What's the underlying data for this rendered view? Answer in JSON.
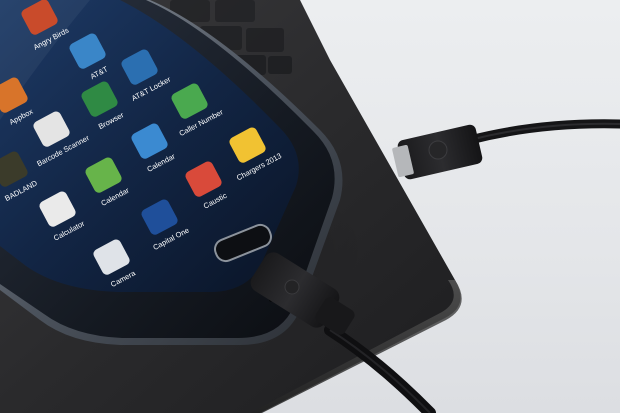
{
  "scene": {
    "subject": "phone-charging-from-laptop"
  },
  "apps": [
    {
      "label": "Angry Birds",
      "icon": "angry-birds-icon",
      "color": "#c94b2b"
    },
    {
      "label": "AT&T",
      "icon": "att-icon",
      "color": "#3a86c8"
    },
    {
      "label": "AT&T Locker",
      "icon": "att-locker-icon",
      "color": "#2b6fb1"
    },
    {
      "label": "Appbox",
      "icon": "appbox-icon",
      "color": "#d8742a"
    },
    {
      "label": "Barcode Scanner",
      "icon": "barcode-scanner-icon",
      "color": "#e4e4e4"
    },
    {
      "label": "Browser",
      "icon": "browser-icon",
      "color": "#2f8a44"
    },
    {
      "label": "Caller Number",
      "icon": "caller-number-icon",
      "color": "#4aa94f"
    },
    {
      "label": "BADLAND",
      "icon": "badland-icon",
      "color": "#3b3b2a"
    },
    {
      "label": "Calculator",
      "icon": "calculator-icon",
      "color": "#eaeaea"
    },
    {
      "label": "Calendar",
      "icon": "calendar-icon",
      "color": "#67b44a"
    },
    {
      "label": "Calendar",
      "icon": "calendar-blue-icon",
      "color": "#3b8ad1"
    },
    {
      "label": "Caustic",
      "icon": "caustic-icon",
      "color": "#d94a3a"
    },
    {
      "label": "Chargers 2013",
      "icon": "chargers-icon",
      "color": "#f1c232"
    },
    {
      "label": "Camera",
      "icon": "camera-icon",
      "color": "#dfe3e8"
    },
    {
      "label": "Capital One",
      "icon": "capital-one-icon",
      "color": "#1f4f9a"
    }
  ],
  "colors": {
    "laptop": "#2a2a2c",
    "phone_body": "#13161b",
    "screen": "#0f1d34",
    "cable": "#121214",
    "background": "#e8e9eb"
  }
}
